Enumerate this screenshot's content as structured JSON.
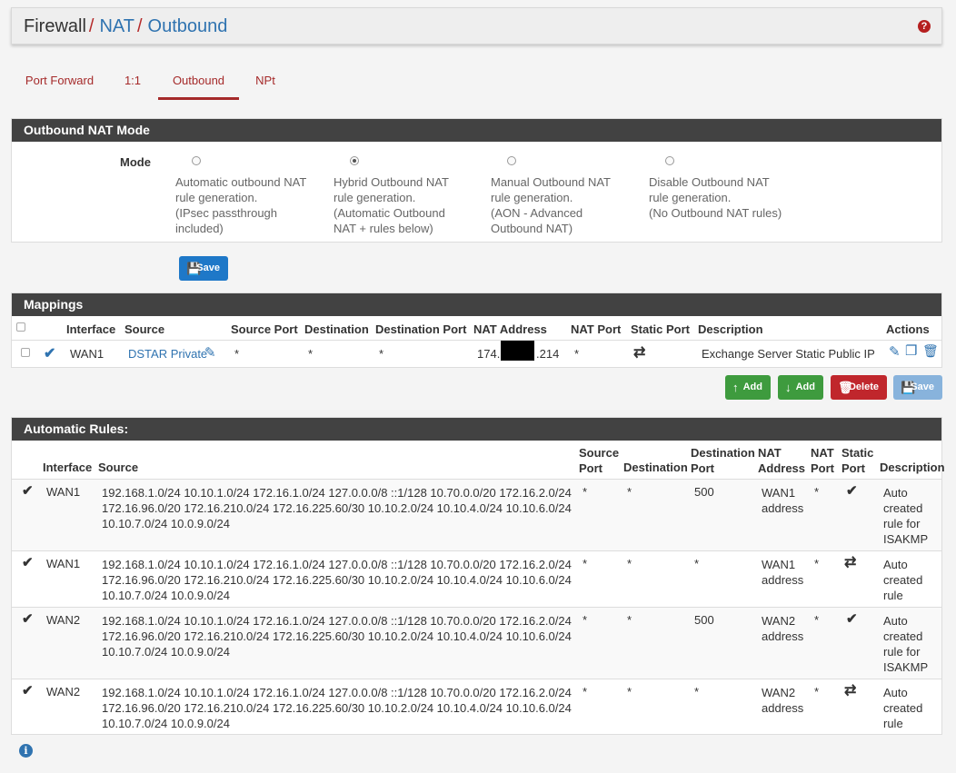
{
  "breadcrumb": {
    "first": "Firewall",
    "second": "NAT",
    "third": "Outbound",
    "sep": "/"
  },
  "help_icon": "?",
  "tabs": [
    {
      "label": "Port Forward"
    },
    {
      "label": "1:1"
    },
    {
      "label": "Outbound"
    },
    {
      "label": "NPt"
    }
  ],
  "outbound_mode": {
    "heading": "Outbound NAT Mode",
    "mode_label": "Mode",
    "options": [
      {
        "lines": [
          "Automatic outbound NAT",
          "rule generation.",
          "(IPsec passthrough",
          "included)"
        ],
        "checked": false
      },
      {
        "lines": [
          "Hybrid Outbound NAT",
          "rule generation.",
          "(Automatic Outbound",
          "NAT + rules below)"
        ],
        "checked": true
      },
      {
        "lines": [
          "Manual Outbound NAT",
          "rule generation.",
          "(AON - Advanced",
          "Outbound NAT)"
        ],
        "checked": false
      },
      {
        "lines": [
          "Disable Outbound NAT",
          "rule generation.",
          "(No Outbound NAT rules)"
        ],
        "checked": false
      }
    ],
    "save_label": "Save"
  },
  "mappings": {
    "heading": "Mappings",
    "columns": [
      "Interface",
      "Source",
      "Source Port",
      "Destination",
      "Destination Port",
      "NAT Address",
      "NAT Port",
      "Static Port",
      "Description",
      "Actions"
    ],
    "rows": [
      {
        "interface": "WAN1",
        "source": "DSTAR Private",
        "source_port": "*",
        "destination": "*",
        "destination_port": "*",
        "nat_address_prefix": "174.",
        "nat_address_suffix": ".214",
        "nat_port": "*",
        "description": "Exchange Server Static Public IP"
      }
    ],
    "buttons": {
      "add_top": "Add",
      "add_bottom": "Add",
      "delete": "Delete",
      "save": "Save"
    }
  },
  "automatic_rules": {
    "heading": "Automatic Rules:",
    "columns": {
      "interface": "Interface",
      "source": "Source",
      "source_port": [
        "Source",
        "Port"
      ],
      "destination": "Destination",
      "destination_port": [
        "Destination",
        "Port"
      ],
      "nat_address": [
        "NAT",
        "Address"
      ],
      "nat_port": [
        "NAT",
        "Port"
      ],
      "static_port": [
        "Static",
        "Port"
      ],
      "description": "Description"
    },
    "rows": [
      {
        "interface": "WAN1",
        "source": [
          "192.168.1.0/24 10.10.1.0/24 172.16.1.0/24 127.0.0.0/8 ::1/128 10.70.0.0/20 172.16.2.0/24",
          "172.16.96.0/20 172.16.210.0/24 172.16.225.60/30 10.10.2.0/24 10.10.4.0/24 10.10.6.0/24",
          "10.10.7.0/24 10.0.9.0/24"
        ],
        "source_port": "*",
        "destination": "*",
        "destination_port": "500",
        "nat_address": [
          "WAN1",
          "address"
        ],
        "nat_port": "*",
        "static_port_icon": "check-icon",
        "description": [
          "Auto",
          "created",
          "rule for",
          "ISAKMP"
        ]
      },
      {
        "interface": "WAN1",
        "source": [
          "192.168.1.0/24 10.10.1.0/24 172.16.1.0/24 127.0.0.0/8 ::1/128 10.70.0.0/20 172.16.2.0/24",
          "172.16.96.0/20 172.16.210.0/24 172.16.225.60/30 10.10.2.0/24 10.10.4.0/24 10.10.6.0/24",
          "10.10.7.0/24 10.0.9.0/24"
        ],
        "source_port": "*",
        "destination": "*",
        "destination_port": "*",
        "nat_address": [
          "WAN1",
          "address"
        ],
        "nat_port": "*",
        "static_port_icon": "shuffle-icon",
        "description": [
          "Auto",
          "created",
          "rule"
        ]
      },
      {
        "interface": "WAN2",
        "source": [
          "192.168.1.0/24 10.10.1.0/24 172.16.1.0/24 127.0.0.0/8 ::1/128 10.70.0.0/20 172.16.2.0/24",
          "172.16.96.0/20 172.16.210.0/24 172.16.225.60/30 10.10.2.0/24 10.10.4.0/24 10.10.6.0/24",
          "10.10.7.0/24 10.0.9.0/24"
        ],
        "source_port": "*",
        "destination": "*",
        "destination_port": "500",
        "nat_address": [
          "WAN2",
          "address"
        ],
        "nat_port": "*",
        "static_port_icon": "check-icon",
        "description": [
          "Auto",
          "created",
          "rule for",
          "ISAKMP"
        ]
      },
      {
        "interface": "WAN2",
        "source": [
          "192.168.1.0/24 10.10.1.0/24 172.16.1.0/24 127.0.0.0/8 ::1/128 10.70.0.0/20 172.16.2.0/24",
          "172.16.96.0/20 172.16.210.0/24 172.16.225.60/30 10.10.2.0/24 10.10.4.0/24 10.10.6.0/24",
          "10.10.7.0/24 10.0.9.0/24"
        ],
        "source_port": "*",
        "destination": "*",
        "destination_port": "*",
        "nat_address": [
          "WAN2",
          "address"
        ],
        "nat_port": "*",
        "static_port_icon": "shuffle-icon",
        "description": [
          "Auto",
          "created",
          "rule"
        ]
      }
    ]
  },
  "info_icon": "i",
  "colors": {
    "accent": "#a52a2a",
    "link": "#2f73b0",
    "panel_heading": "#424242",
    "btn_blue": "#1e78c8",
    "btn_green": "#3e9b3e",
    "btn_red": "#c0262c"
  }
}
